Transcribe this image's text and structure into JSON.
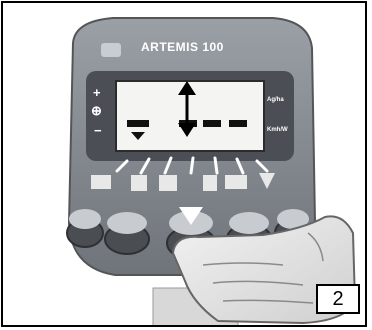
{
  "device": {
    "title": "ARTEMIS 100",
    "lcd": {
      "side_labels": [
        "Ag/ha",
        "Kmh/W"
      ],
      "left_symbols": [
        "+",
        "⊕",
        "−"
      ]
    }
  },
  "step": {
    "number": "2"
  },
  "colors": {
    "body": "#8a8f96",
    "lcd": "#f4f4f2",
    "keypad": "#4a4d52"
  }
}
